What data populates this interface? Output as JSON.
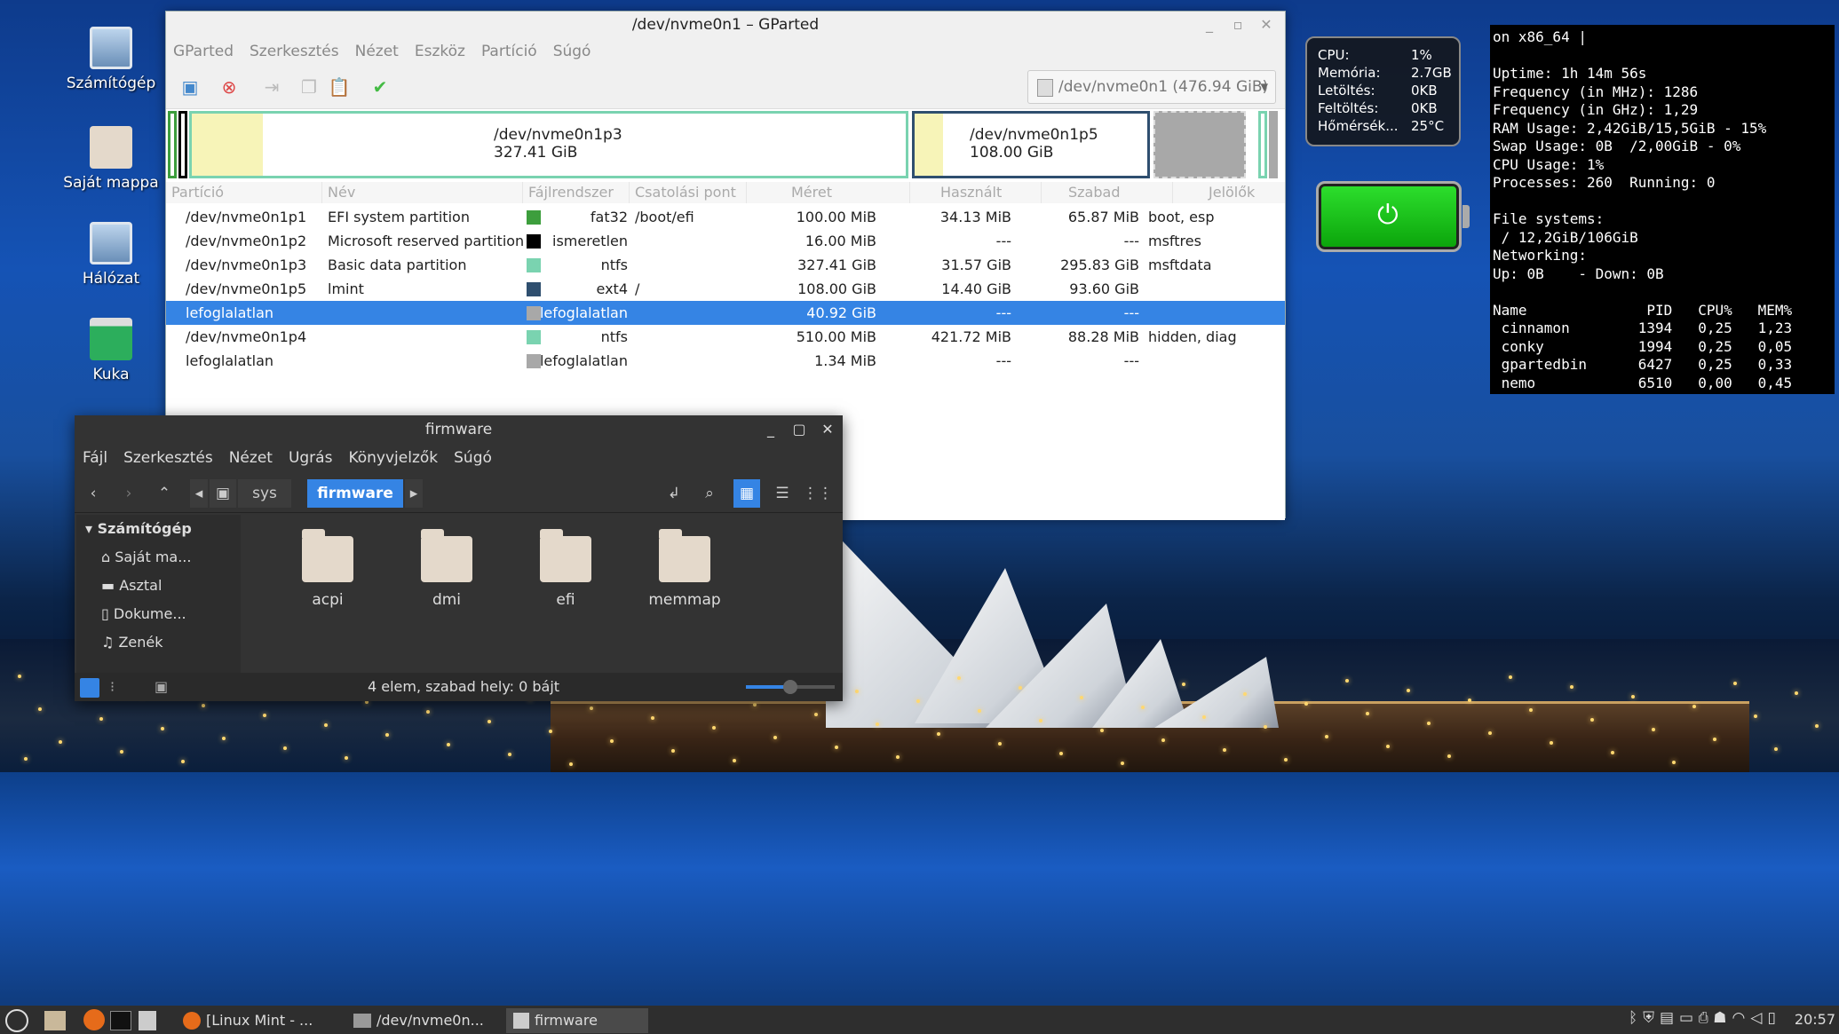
{
  "desktop": {
    "icons": [
      {
        "label": "Számítógép"
      },
      {
        "label": "Saját mappa"
      },
      {
        "label": "Hálózat"
      },
      {
        "label": "Kuka"
      }
    ]
  },
  "gparted": {
    "title": "/dev/nvme0n1 – GParted",
    "menu": [
      "GParted",
      "Szerkesztés",
      "Nézet",
      "Eszköz",
      "Partíció",
      "Súgó"
    ],
    "device_selector": "/dev/nvme0n1 (476.94 GiB)",
    "map": {
      "p3_name": "/dev/nvme0n1p3",
      "p3_size": "327.41 GiB",
      "p5_name": "/dev/nvme0n1p5",
      "p5_size": "108.00 GiB"
    },
    "columns": [
      "Partíció",
      "Név",
      "Fájlrendszer",
      "Csatolási pont",
      "Méret",
      "Használt",
      "Szabad",
      "Jelölők"
    ],
    "rows": [
      {
        "partition": "/dev/nvme0n1p1",
        "name": "EFI system partition",
        "fs": "fat32",
        "mount": "/boot/efi",
        "size": "100.00 MiB",
        "used": "34.13 MiB",
        "free": "65.87 MiB",
        "flags": "boot, esp",
        "color": "#3d9e3d"
      },
      {
        "partition": "/dev/nvme0n1p2",
        "name": "Microsoft reserved partition",
        "fs": "ismeretlen",
        "mount": "",
        "size": "16.00 MiB",
        "used": "---",
        "free": "---",
        "flags": "msftres",
        "color": "#000000"
      },
      {
        "partition": "/dev/nvme0n1p3",
        "name": "Basic data partition",
        "fs": "ntfs",
        "mount": "",
        "size": "327.41 GiB",
        "used": "31.57 GiB",
        "free": "295.83 GiB",
        "flags": "msftdata",
        "color": "#7ad3b0"
      },
      {
        "partition": "/dev/nvme0n1p5",
        "name": "lmint",
        "fs": "ext4",
        "mount": "/",
        "size": "108.00 GiB",
        "used": "14.40 GiB",
        "free": "93.60 GiB",
        "flags": "",
        "color": "#2f4f6f"
      },
      {
        "partition": "lefoglalatlan",
        "name": "",
        "fs": "lefoglalatlan",
        "mount": "",
        "size": "40.92 GiB",
        "used": "---",
        "free": "---",
        "flags": "",
        "color": "#a8a8a8"
      },
      {
        "partition": "/dev/nvme0n1p4",
        "name": "",
        "fs": "ntfs",
        "mount": "",
        "size": "510.00 MiB",
        "used": "421.72 MiB",
        "free": "88.28 MiB",
        "flags": "hidden, diag",
        "color": "#7ad3b0"
      },
      {
        "partition": "lefoglalatlan",
        "name": "",
        "fs": "lefoglalatlan",
        "mount": "",
        "size": "1.34 MiB",
        "used": "---",
        "free": "---",
        "flags": "",
        "color": "#a8a8a8"
      }
    ]
  },
  "nemo": {
    "title": "firmware",
    "menu": [
      "Fájl",
      "Szerkesztés",
      "Nézet",
      "Ugrás",
      "Könyvjelzők",
      "Súgó"
    ],
    "path": [
      "sys",
      "firmware"
    ],
    "sidebar_header": "Számítógép",
    "sidebar": [
      "Saját ma...",
      "Asztal",
      "Dokume...",
      "Zenék"
    ],
    "files": [
      "acpi",
      "dmi",
      "efi",
      "memmap"
    ],
    "status": "4 elem, szabad hely: 0 bájt"
  },
  "conky_small": [
    {
      "k": "CPU:",
      "v": "1%"
    },
    {
      "k": "Memória:",
      "v": "2.7GB"
    },
    {
      "k": "Letöltés:",
      "v": "0KB"
    },
    {
      "k": "Feltöltés:",
      "v": "0KB"
    },
    {
      "k": "Hőmérsék...",
      "v": "25°C"
    }
  ],
  "conky_big": [
    "on x86_64 |",
    "",
    "Uptime: 1h 14m 56s",
    "Frequency (in MHz): 1286",
    "Frequency (in GHz): 1,29",
    "RAM Usage: 2,42GiB/15,5GiB - 15%",
    "Swap Usage: 0B  /2,00GiB - 0%",
    "CPU Usage: 1%",
    "Processes: 260  Running: 0",
    "",
    "File systems:",
    " / 12,2GiB/106GiB",
    "Networking:",
    "Up: 0B    - Down: 0B",
    "",
    "Name              PID   CPU%   MEM%",
    " cinnamon        1394   0,25   1,23",
    " conky           1994   0,25   0,05",
    " gpartedbin      6427   0,25   0,33",
    " nemo            6510   0,00   0,45"
  ],
  "taskbar": {
    "windows": [
      "[Linux Mint - ...",
      "/dev/nvme0n...",
      "firmware"
    ],
    "clock": "20:57"
  }
}
